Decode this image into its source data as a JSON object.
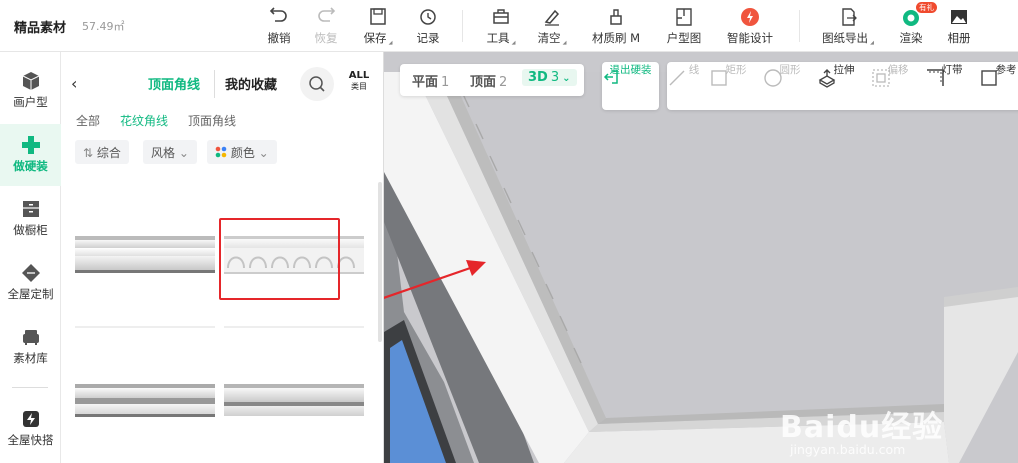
{
  "app": {
    "brand": "精品素材",
    "area": "57.49㎡"
  },
  "toolbar": {
    "undo": "撤销",
    "redo": "恢复",
    "save": "保存",
    "record": "记录",
    "tools": "工具",
    "clear": "清空",
    "material_brush": "材质刷 M",
    "floor_plan": "户型图",
    "smart_design": "智能设计",
    "export_drawing": "图纸导出",
    "render": "渲染",
    "render_badge": "有礼",
    "album": "相册"
  },
  "rail": {
    "items": [
      {
        "label": "画户型",
        "icon": "cube-icon"
      },
      {
        "label": "做硬装",
        "icon": "plus-icon",
        "active": true
      },
      {
        "label": "做橱柜",
        "icon": "cabinet-icon"
      },
      {
        "label": "全屋定制",
        "icon": "custom-icon"
      },
      {
        "label": "素材库",
        "icon": "sofa-icon"
      },
      {
        "label": "全屋快搭",
        "icon": "lightning-icon"
      }
    ]
  },
  "panel": {
    "tabs": [
      "顶面角线",
      "我的收藏"
    ],
    "all_label": "ALL",
    "all_sub": "类目",
    "breadcrumbs": [
      "全部",
      "花纹角线",
      "顶面角线"
    ],
    "filters": [
      "综合",
      "风格",
      "颜色"
    ]
  },
  "viewport": {
    "views": [
      {
        "label": "平面",
        "num": "1"
      },
      {
        "label": "顶面",
        "num": "2"
      },
      {
        "label": "3D",
        "num": "3",
        "active": true
      }
    ],
    "exit": "退出硬装",
    "draw_tools": [
      "线",
      "矩形",
      "圆形",
      "拉伸",
      "偏移",
      "灯带",
      "参考"
    ],
    "watermark": "Baidu经验",
    "watermark_url": "jingyan.baidu.com"
  },
  "colors": {
    "accent": "#10b981",
    "highlight": "#e5262a"
  }
}
